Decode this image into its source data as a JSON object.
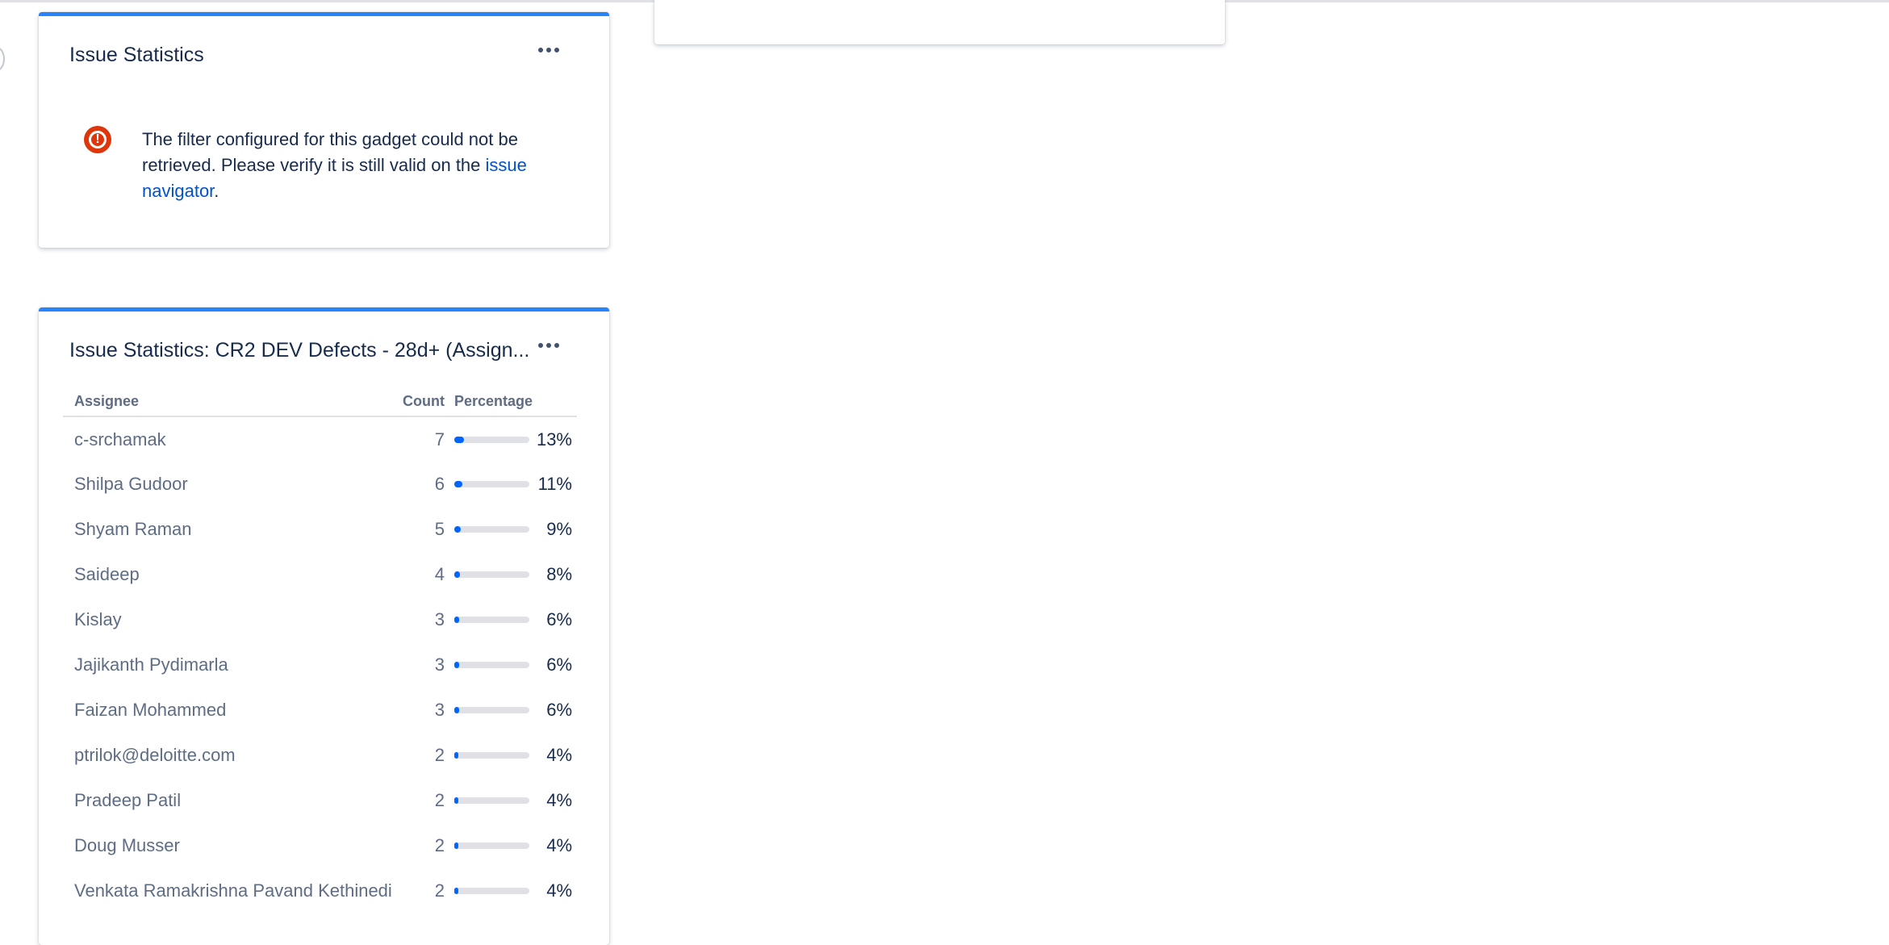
{
  "gadget_error": {
    "title": "Issue Statistics",
    "message": "The filter configured for this gadget could not be retrieved. Please verify it is still valid on the",
    "link_text": "issue navigator",
    "suffix": ".",
    "icon": "error-icon"
  },
  "gadget_stats": {
    "title": "Issue Statistics: CR2 DEV Defects - 28d+ (Assign...",
    "columns": {
      "assignee": "Assignee",
      "count": "Count",
      "percentage": "Percentage"
    },
    "rows": [
      {
        "name": "c-srchamak",
        "count": "7",
        "percent": "13%",
        "fraction": 0.13
      },
      {
        "name": "Shilpa Gudoor",
        "count": "6",
        "percent": "11%",
        "fraction": 0.11
      },
      {
        "name": "Shyam Raman",
        "count": "5",
        "percent": "9%",
        "fraction": 0.09
      },
      {
        "name": "Saideep",
        "count": "4",
        "percent": "8%",
        "fraction": 0.08
      },
      {
        "name": "Kislay",
        "count": "3",
        "percent": "6%",
        "fraction": 0.06
      },
      {
        "name": "Jajikanth Pydimarla",
        "count": "3",
        "percent": "6%",
        "fraction": 0.06
      },
      {
        "name": "Faizan Mohammed",
        "count": "3",
        "percent": "6%",
        "fraction": 0.06
      },
      {
        "name": "ptrilok@deloitte.com",
        "count": "2",
        "percent": "4%",
        "fraction": 0.04
      },
      {
        "name": "Pradeep Patil",
        "count": "2",
        "percent": "4%",
        "fraction": 0.04
      },
      {
        "name": "Doug Musser",
        "count": "2",
        "percent": "4%",
        "fraction": 0.04
      },
      {
        "name": "Venkata Ramakrishna Pavand Kethinedi",
        "count": "2",
        "percent": "4%",
        "fraction": 0.04
      }
    ]
  },
  "colors": {
    "accent": "#2684ff",
    "bar_fill": "#0065ff",
    "bar_track": "#dfe1e6",
    "error": "#de350b",
    "link": "#0052cc"
  }
}
